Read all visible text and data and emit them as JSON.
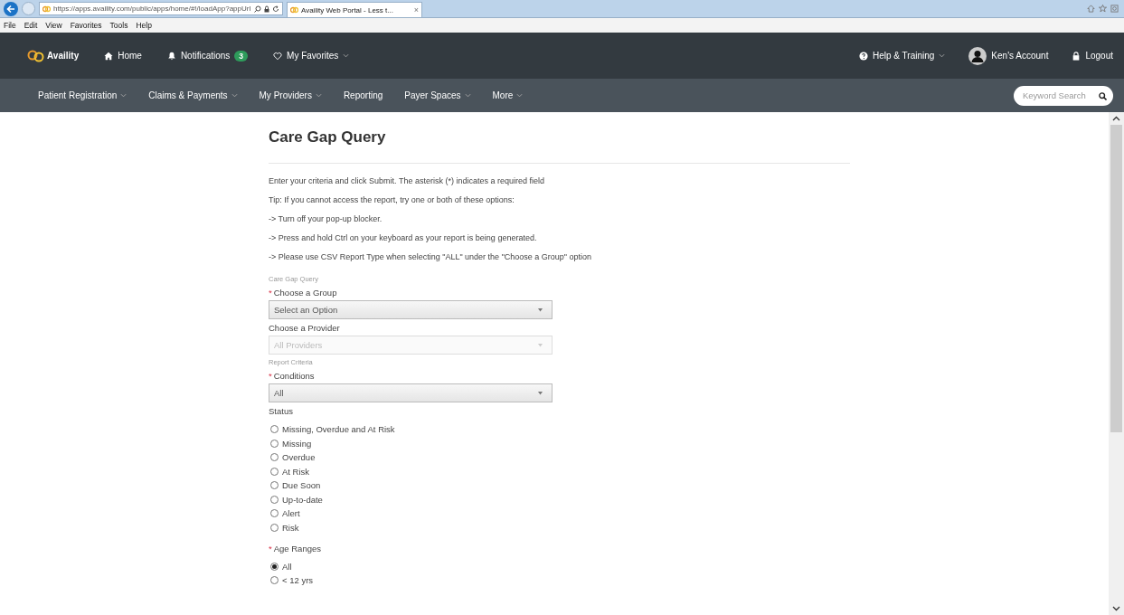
{
  "browser": {
    "url": "https://apps.availity.com/public/apps/home/#!/loadApp?appUrl",
    "tab_title": "Availity Web Portal - Less t...",
    "tab_close": "×",
    "menu": [
      "File",
      "Edit",
      "View",
      "Favorites",
      "Tools",
      "Help"
    ]
  },
  "top_nav": {
    "brand": "Availity",
    "items": [
      {
        "label": "Home",
        "caret": false
      },
      {
        "label": "Notifications",
        "badge": "3",
        "caret": false
      },
      {
        "label": "My Favorites",
        "caret": true
      }
    ],
    "right": [
      {
        "label": "Help & Training",
        "caret": true
      },
      {
        "label": "Ken's Account",
        "caret": false
      },
      {
        "label": "Logout",
        "caret": false
      }
    ]
  },
  "sub_nav": {
    "items": [
      {
        "label": "Patient Registration",
        "caret": true
      },
      {
        "label": "Claims & Payments",
        "caret": true
      },
      {
        "label": "My Providers",
        "caret": true
      },
      {
        "label": "Reporting",
        "caret": false
      },
      {
        "label": "Payer Spaces",
        "caret": true
      },
      {
        "label": "More",
        "caret": true
      }
    ],
    "search": {
      "placeholder": "Keyword Search"
    }
  },
  "page": {
    "title": "Care Gap Query",
    "instructions": [
      "Enter your criteria and click Submit. The asterisk (*) indicates a required field",
      "Tip: If you cannot access the report, try one or both of these options:",
      "-> Turn off your pop-up blocker.",
      "-> Press and hold Ctrl on your keyboard as your report is being generated.",
      "-> Please use CSV Report Type when selecting \"ALL\" under the \"Choose a Group\" option"
    ],
    "form": [
      {
        "kind": "caption",
        "text": "Care Gap Query"
      },
      {
        "kind": "label",
        "text": "Choose a Group",
        "asterisk": "*"
      },
      {
        "kind": "select",
        "value": "Select an Option",
        "disabled": false
      },
      {
        "kind": "label",
        "text": "Choose a Provider"
      },
      {
        "kind": "select",
        "value": "All Providers",
        "disabled": true
      },
      {
        "kind": "caption",
        "text": "Report Criteria"
      },
      {
        "kind": "label",
        "text": "Conditions",
        "asterisk": "*"
      },
      {
        "kind": "select",
        "value": "All",
        "disabled": false
      },
      {
        "kind": "label",
        "text": "Status"
      },
      {
        "kind": "radios",
        "options": [
          {
            "label": "Missing, Overdue and At Risk",
            "selected": false
          },
          {
            "label": "Missing",
            "selected": false
          },
          {
            "label": "Overdue",
            "selected": false
          },
          {
            "label": "At Risk",
            "selected": false
          },
          {
            "label": "Due Soon",
            "selected": false
          },
          {
            "label": "Up-to-date",
            "selected": false
          },
          {
            "label": "Alert",
            "selected": false
          },
          {
            "label": "Risk",
            "selected": false
          }
        ]
      },
      {
        "kind": "label",
        "text": "Age Ranges",
        "asterisk": "*"
      },
      {
        "kind": "radios",
        "options": [
          {
            "label": "All",
            "selected": true
          },
          {
            "label": "< 12 yrs",
            "selected": false
          }
        ]
      }
    ]
  }
}
